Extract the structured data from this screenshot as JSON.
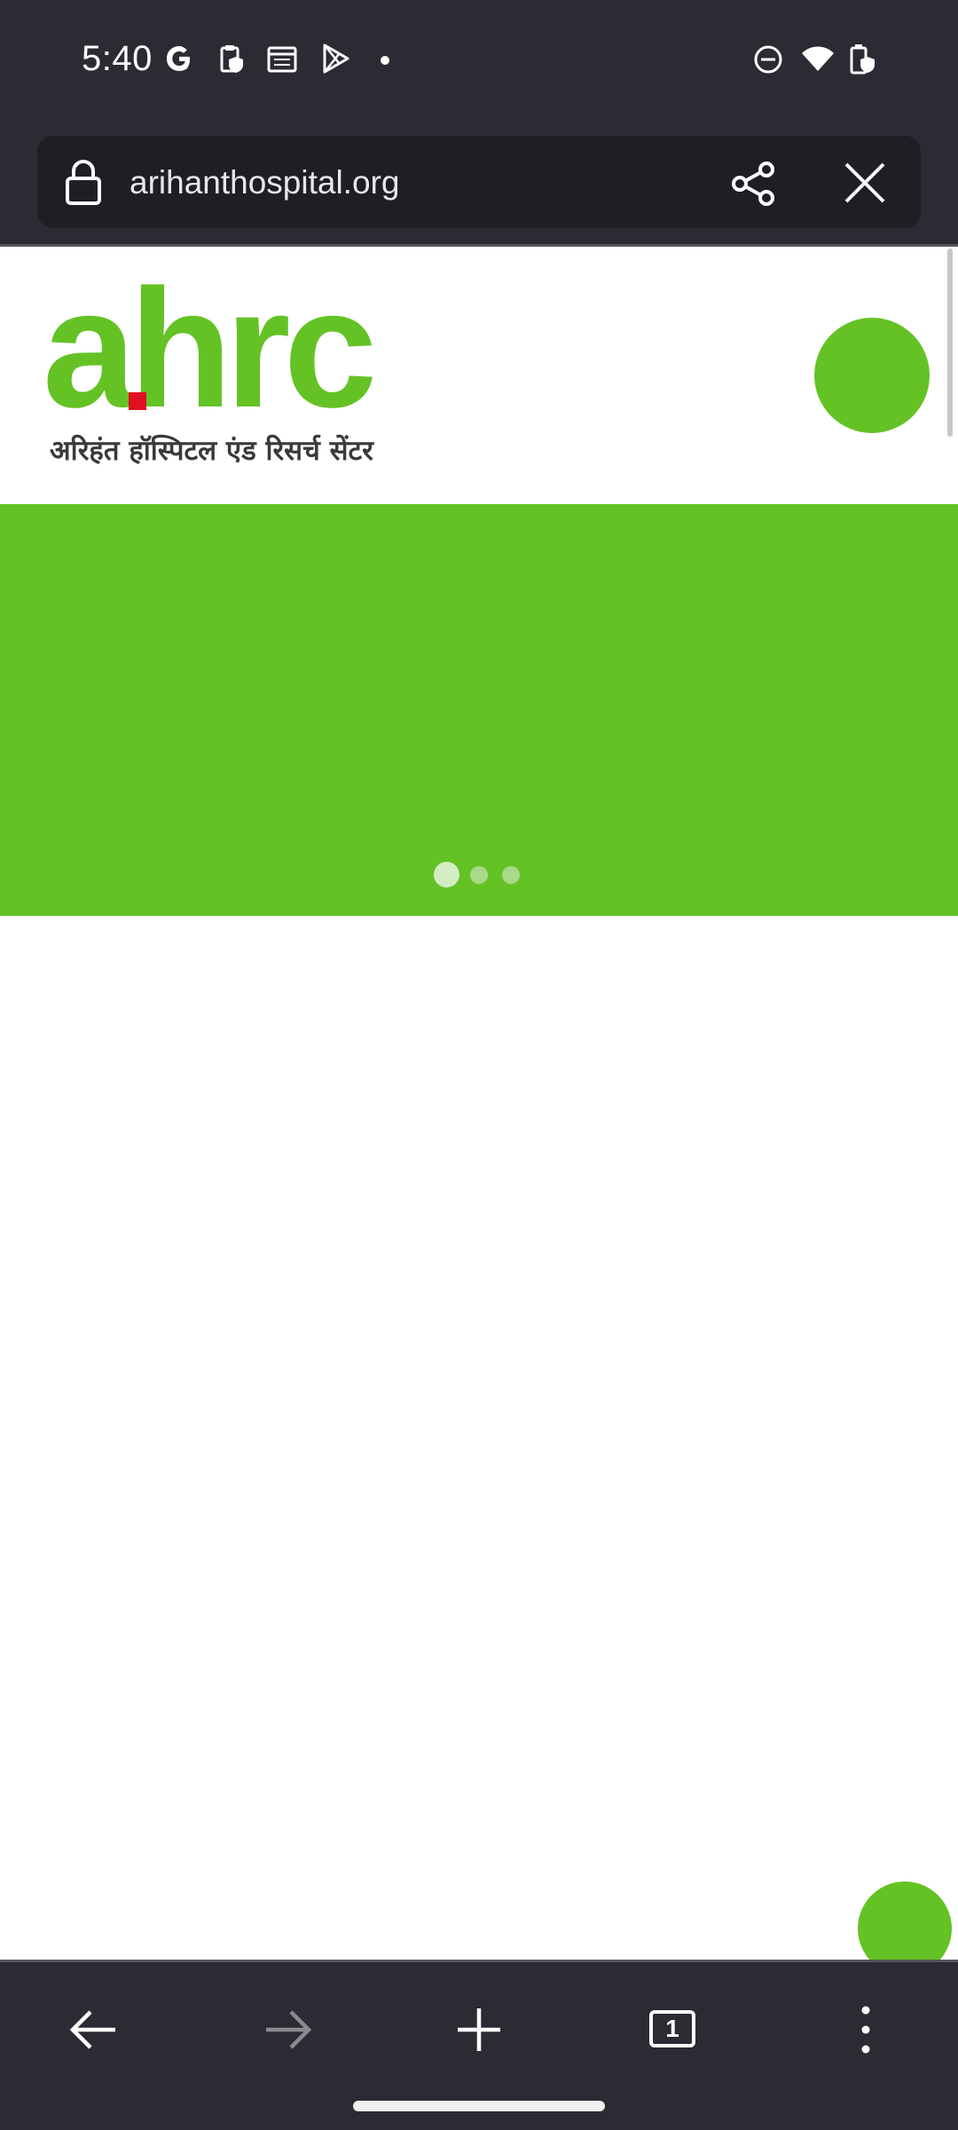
{
  "status_bar": {
    "time": "5:40",
    "left_icons": [
      "google-g-icon",
      "clipboard-shield-icon",
      "calendar-icon",
      "play-store-icon",
      "notification-dot-icon"
    ],
    "right_icons": [
      "do-not-disturb-icon",
      "wifi-icon",
      "battery-charging-icon"
    ]
  },
  "toolbar": {
    "url": "arihanthospital.org",
    "icons": [
      "lock-icon",
      "share-icon",
      "close-icon"
    ]
  },
  "site": {
    "logo_text": "ahrc",
    "logo_hindi": "अरिहंत हॉस्पिटल एंड रिसर्च सेंटर",
    "brand_color": "#64c225",
    "logo_accent_color": "#e01020",
    "carousel": {
      "slide_count": 3,
      "active_slide": 1
    }
  },
  "bottom_bar": {
    "buttons": [
      "back-icon",
      "forward-icon",
      "new-tab-icon",
      "tab-switcher-icon",
      "more-menu-icon"
    ],
    "tab_count": "1"
  }
}
